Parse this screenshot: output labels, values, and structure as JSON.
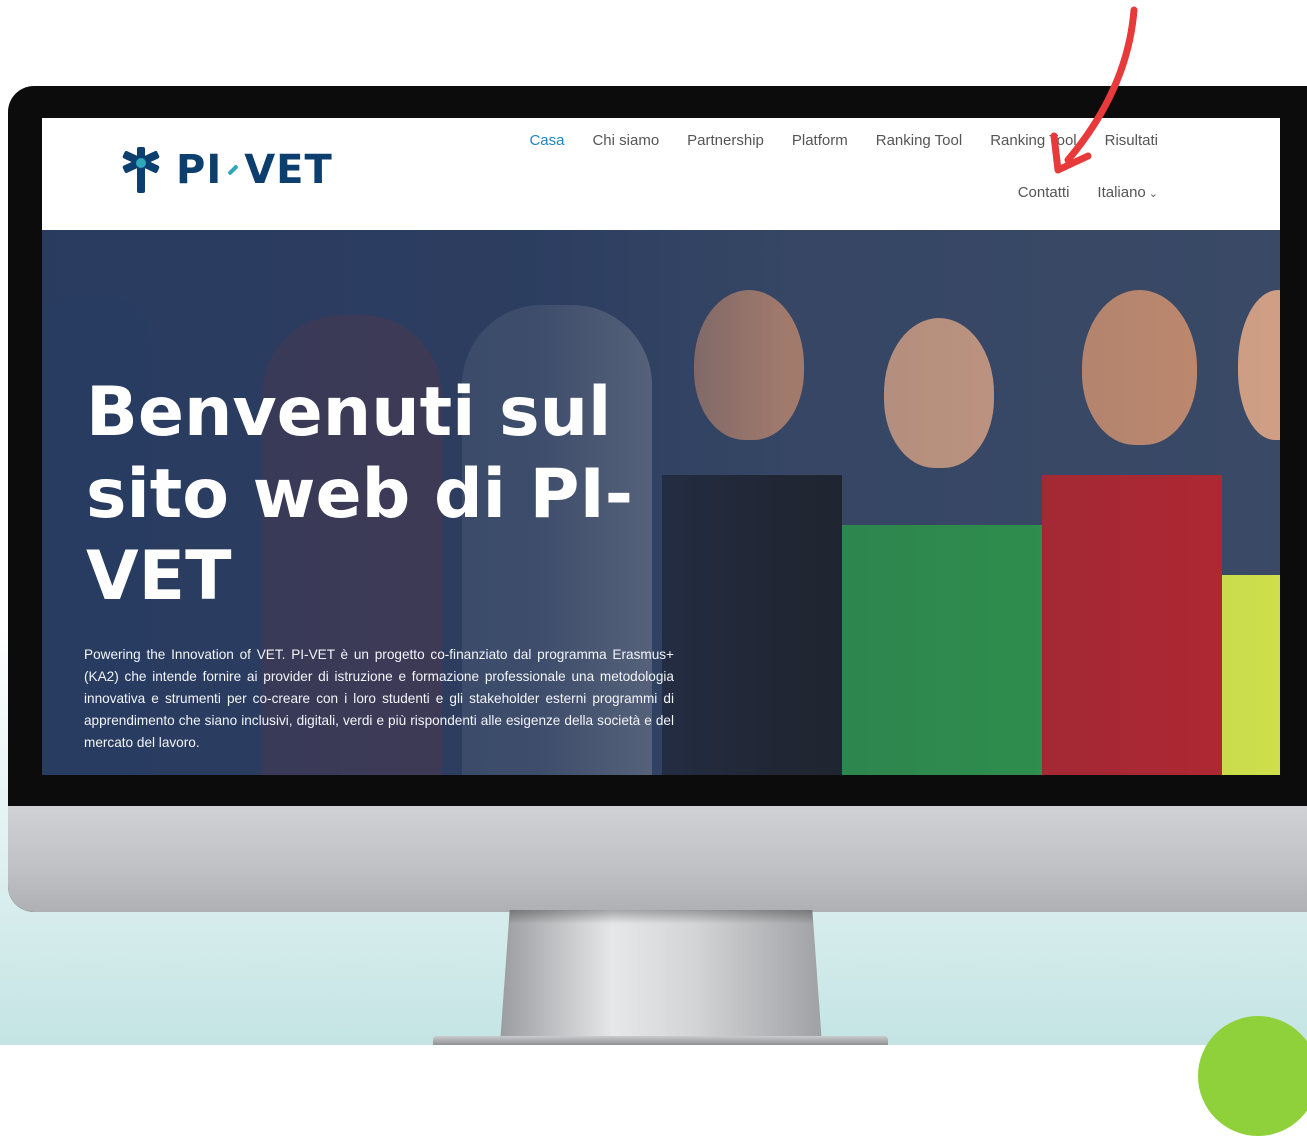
{
  "site": {
    "logo_text_left": "PI",
    "logo_text_right": "VET",
    "brand_color": "#0d3f6e",
    "accent_color": "#1f86c2"
  },
  "nav": {
    "row1": [
      {
        "label": "Casa",
        "active": true
      },
      {
        "label": "Chi siamo",
        "active": false
      },
      {
        "label": "Partnership",
        "active": false
      },
      {
        "label": "Platform",
        "active": false
      },
      {
        "label": "Ranking Tool",
        "active": false
      },
      {
        "label": "Ranking Tool",
        "active": false
      },
      {
        "label": "Risultati",
        "active": false
      }
    ],
    "row2": [
      {
        "label": "Contatti",
        "active": false
      },
      {
        "label": "Italiano",
        "active": false,
        "dropdown": true
      }
    ]
  },
  "hero": {
    "title": "Benvenuti sul sito web di PI-VET",
    "text": "Powering the Innovation of VET. PI-VET è un progetto co-finanziato dal programma Erasmus+ (KA2) che intende fornire ai provider di istruzione e formazione professionale una metodologia innovativa e strumenti per co-creare con i loro studenti e gli stakeholder esterni programmi di apprendimento che siano inclusivi, digitali, verdi e più rispondenti alle esigenze della società e del mercato del lavoro."
  },
  "annotation": {
    "arrow_color": "#e83a3a",
    "arrow_icon": "red-arrow-pointing-to-contatti"
  }
}
